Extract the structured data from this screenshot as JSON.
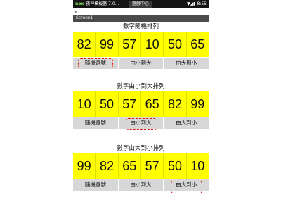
{
  "statusbar": {
    "app_logo": "nox",
    "app_title": "夜神模擬器 7.0...",
    "tab_label": "遊戲中心",
    "time": "8:55"
  },
  "back_glyph": "×",
  "screen_title": "Screen1",
  "sections": [
    {
      "title": "數字隨機排列",
      "numbers": [
        "82",
        "99",
        "57",
        "10",
        "50",
        "65"
      ],
      "buttons": [
        "隨機選號",
        "由小到大",
        "由大到小"
      ],
      "highlighted_button": 0
    },
    {
      "title": "數字由小到大排列",
      "numbers": [
        "10",
        "50",
        "57",
        "65",
        "82",
        "99"
      ],
      "buttons": [
        "隨機選號",
        "由小到大",
        "由大到小"
      ],
      "highlighted_button": 1
    },
    {
      "title": "數字由大到小排列",
      "numbers": [
        "99",
        "82",
        "65",
        "57",
        "50",
        "10"
      ],
      "buttons": [
        "隨機選號",
        "由小到大",
        "由大到小"
      ],
      "highlighted_button": 2
    }
  ],
  "colors": {
    "number_cell": "#ffff00",
    "button": "#d7d7d7",
    "highlight": "#e01010"
  }
}
